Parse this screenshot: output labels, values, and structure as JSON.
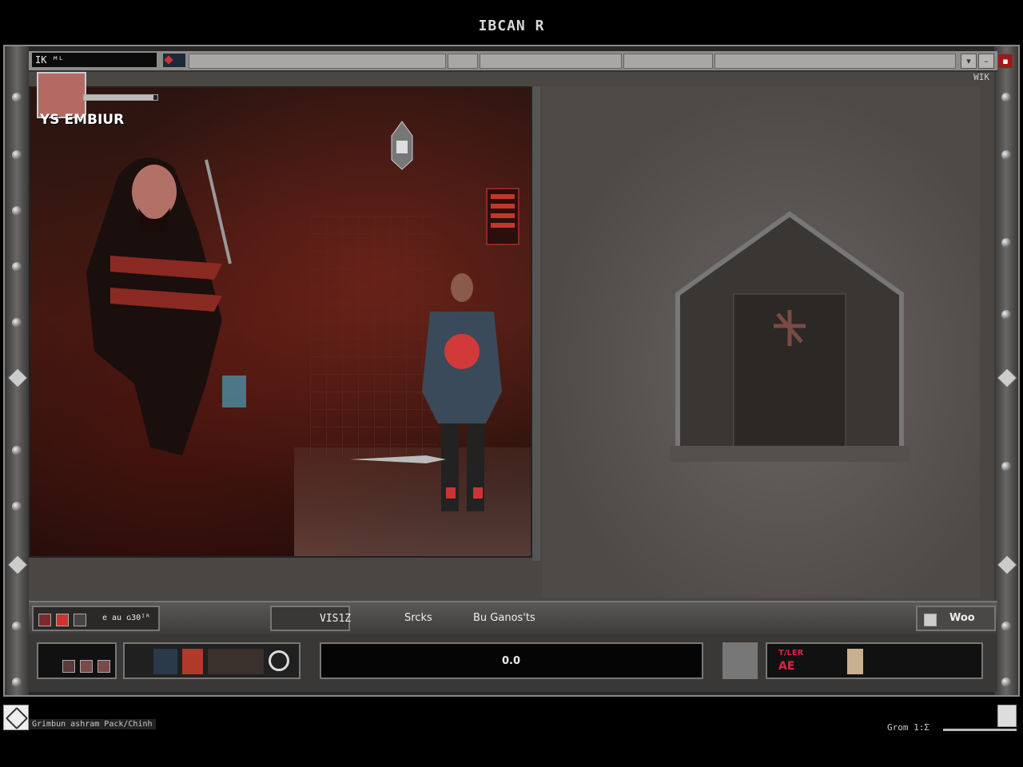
{
  "window_title": "IBCAN R",
  "topbar": {
    "player_tag": "IK  ᴹᴸ",
    "top_right_badge": "WIK"
  },
  "portrait": {
    "name": "YS EMBIUR",
    "hp_fraction": 0.95
  },
  "hud": {
    "left_chip_label": "e au ɢ30ᴵᴿ",
    "turn_label": "VIS1Z",
    "tab_items": [
      "Srcks",
      "Bu Ganos'ts"
    ],
    "right_label": "Woo",
    "center_value": "0.0",
    "gold_top": "T/LER",
    "gold_value": "AE"
  },
  "footer": {
    "left_text": "Grimbun ashram Pack/Chinh",
    "right_text": "Grom 1:Σ"
  },
  "icons": [
    "rivet-icon",
    "diamond-icon",
    "flag-icon",
    "close-icon",
    "shield-icon",
    "gear-icon",
    "map-icon"
  ],
  "colors": {
    "accent": "#9e1a1a",
    "panel": "#4a4644",
    "frame": "#8a8886"
  }
}
